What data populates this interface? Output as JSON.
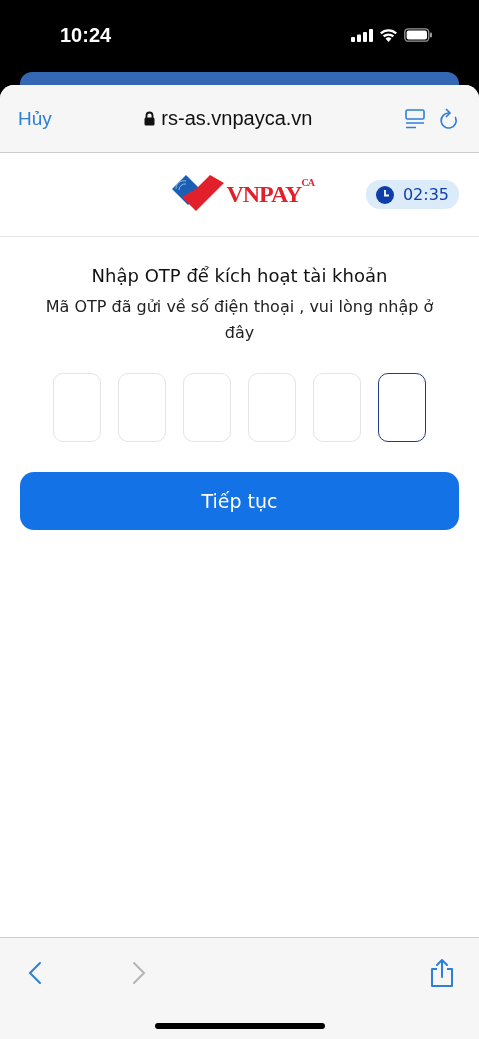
{
  "status_bar": {
    "time": "10:24"
  },
  "browser": {
    "cancel": "Hủy",
    "url": "rs-as.vnpayca.vn",
    "secure": true
  },
  "header": {
    "logo": "VNPAY$^{CA}$",
    "timer": "02:35"
  },
  "form": {
    "title": "Nhập OTP để kích hoạt tài khoản",
    "subtitle": "Mã OTP đã gửi về số điện thoại , vui lòng nhập ở đây",
    "otp_boxes": [
      {
        "focused": false
      },
      {
        "focused": false
      },
      {
        "focused": false
      },
      {
        "focused": false
      },
      {
        "focused": false
      },
      {
        "focused": true
      }
    ],
    "submit": "Tiếp tục"
  },
  "toolbar": {
    "back_disabled": false,
    "forward_disabled": true
  }
}
